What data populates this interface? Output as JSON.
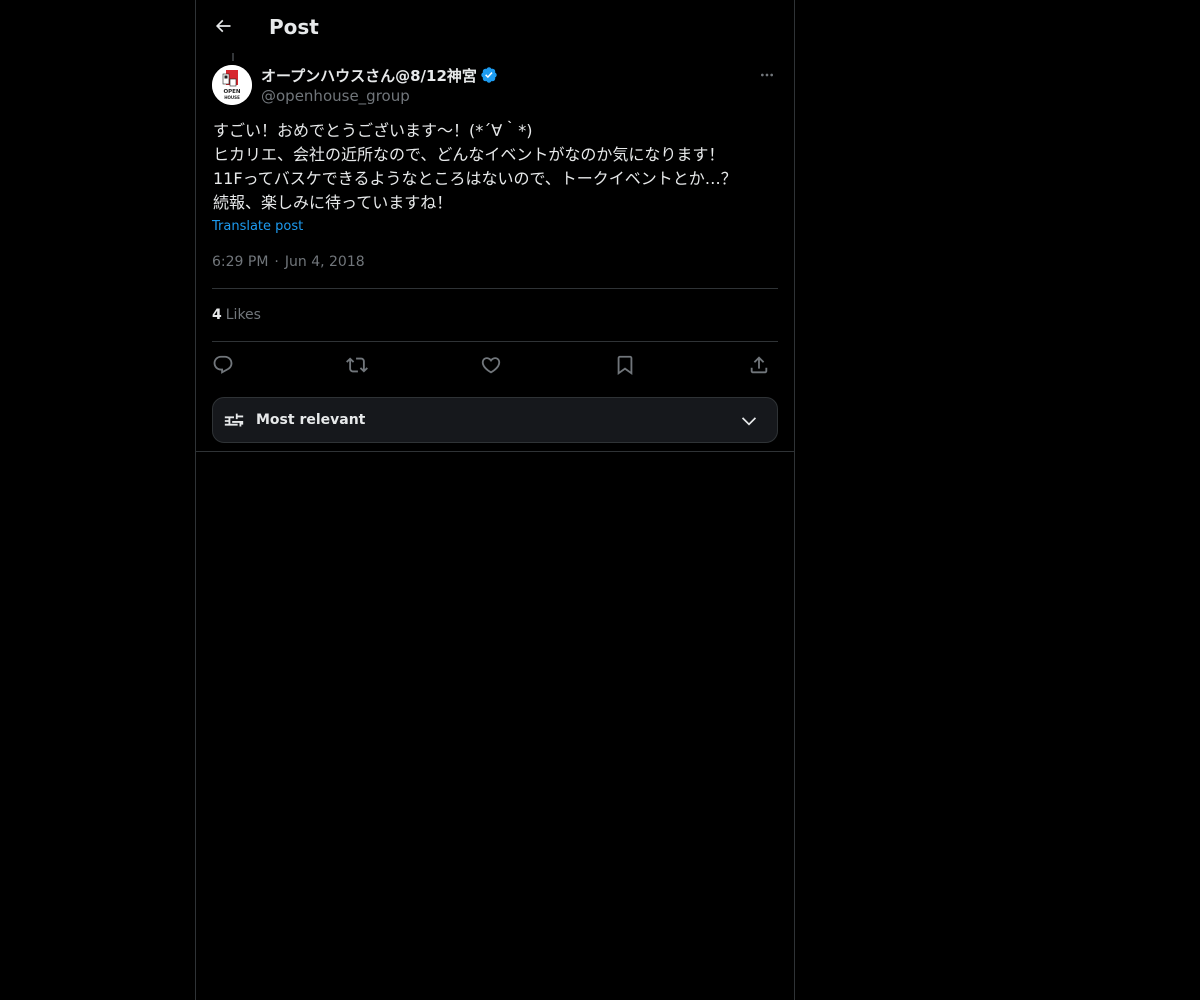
{
  "header": {
    "title": "Post"
  },
  "post": {
    "author": {
      "display_name": "オープンハウスさん@8/12神宮",
      "handle": "@openhouse_group",
      "avatar_text_top": "OPEN",
      "avatar_text_bottom": "HOUSE",
      "verified": true
    },
    "text_lines": [
      "すごい！おめでとうございます〜！(*´∀｀*)",
      "ヒカリエ、会社の近所なので、どんなイベントがなのか気になります！",
      "11Fってバスケできるようなところはないので、トークイベントとか…？",
      "続報、楽しみに待っていますね！"
    ],
    "translate_label": "Translate post",
    "time": "6:29 PM",
    "separator": "·",
    "date": "Jun 4, 2018",
    "likes_count": "4",
    "likes_label": "Likes"
  },
  "actions": {
    "reply": "reply-icon",
    "repost": "repost-icon",
    "like": "heart-icon",
    "bookmark": "bookmark-icon",
    "share": "share-icon"
  },
  "sort": {
    "label": "Most relevant"
  },
  "colors": {
    "background": "#000000",
    "text": "#e7e9ea",
    "muted": "#71767b",
    "accent": "#1d9bf0",
    "border": "#2f3336",
    "brand_red": "#d7282f"
  }
}
